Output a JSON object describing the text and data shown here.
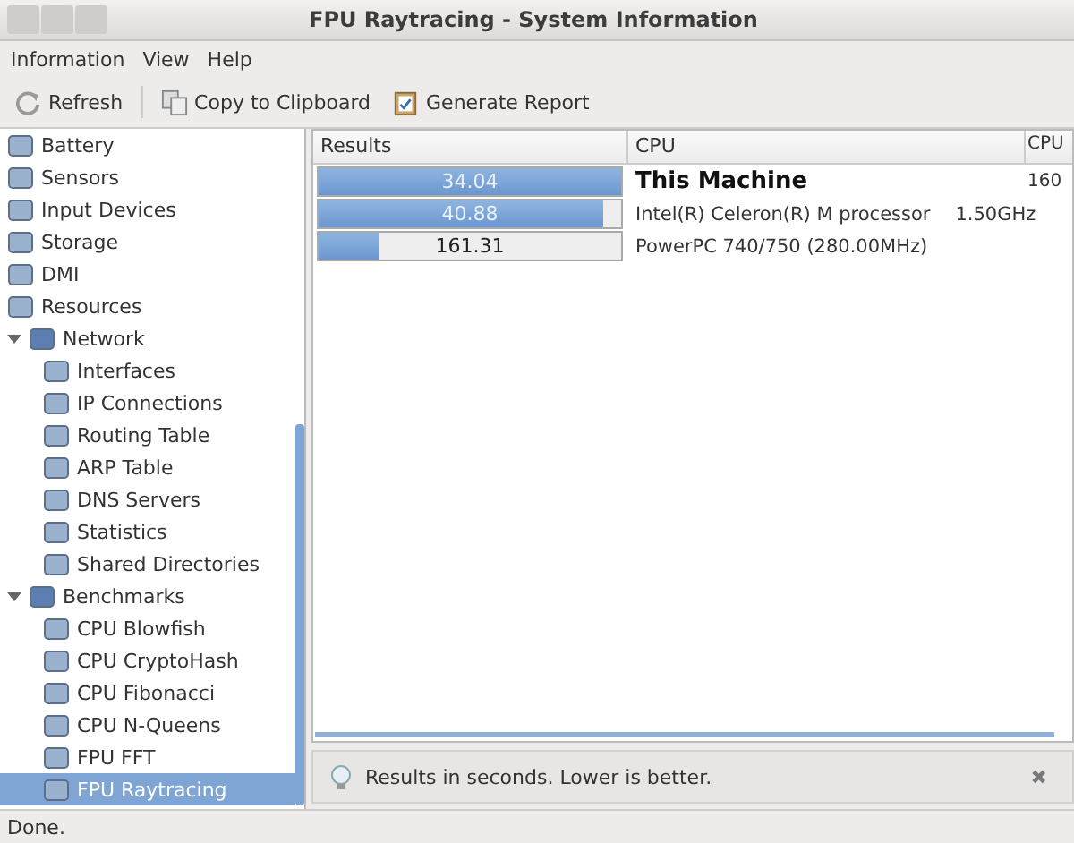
{
  "window": {
    "title": "FPU Raytracing - System Information"
  },
  "menu": [
    "Information",
    "View",
    "Help"
  ],
  "toolbar": [
    {
      "label": "Refresh",
      "kind": "refresh"
    },
    {
      "label": "Copy to Clipboard",
      "kind": "copy"
    },
    {
      "label": "Generate Report",
      "kind": "report"
    }
  ],
  "tree": [
    {
      "children": [
        {
          "label": "Battery",
          "selected": false
        },
        {
          "label": "Sensors",
          "selected": false
        },
        {
          "label": "Input Devices",
          "selected": false
        },
        {
          "label": "Storage",
          "selected": false
        },
        {
          "label": "DMI",
          "selected": false
        },
        {
          "label": "Resources",
          "selected": false
        }
      ]
    },
    {
      "label": "Network",
      "selected": false,
      "expanded": true,
      "children": [
        {
          "label": "Interfaces",
          "selected": false
        },
        {
          "label": "IP Connections",
          "selected": false
        },
        {
          "label": "Routing Table",
          "selected": false
        },
        {
          "label": "ARP Table",
          "selected": false
        },
        {
          "label": "DNS Servers",
          "selected": false
        },
        {
          "label": "Statistics",
          "selected": false
        },
        {
          "label": "Shared Directories",
          "selected": false
        }
      ]
    },
    {
      "label": "Benchmarks",
      "selected": false,
      "expanded": true,
      "children": [
        {
          "label": "CPU Blowfish",
          "selected": false
        },
        {
          "label": "CPU CryptoHash",
          "selected": false
        },
        {
          "label": "CPU Fibonacci",
          "selected": false
        },
        {
          "label": "CPU N-Queens",
          "selected": false
        },
        {
          "label": "FPU FFT",
          "selected": false
        },
        {
          "label": "FPU Raytracing",
          "selected": true
        }
      ]
    }
  ],
  "table": {
    "columns": [
      "Results",
      "CPU",
      "CPU"
    ],
    "rows": [
      {
        "result": "34.04",
        "level": 1,
        "cpu": "This Machine",
        "highlighted": true,
        "column_3": "160"
      },
      {
        "result": "40.88",
        "level": 0.94,
        "cpu": "Intel(R) Celeron(R) M processor",
        "clock": "1.50GHz",
        "highlighted": false
      },
      {
        "result": "161.31",
        "level": 0.2,
        "cpu": "PowerPC 740/750 (280.00MHz)",
        "highlighted": false
      }
    ]
  },
  "info_bar": {
    "text": "Results in seconds. Lower is better.",
    "close": "✖"
  },
  "status_bar": "Done."
}
